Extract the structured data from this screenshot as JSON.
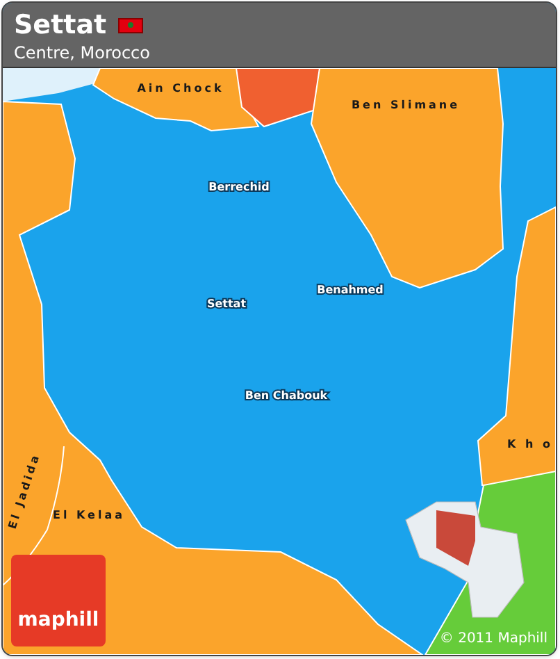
{
  "header": {
    "title": "Settat",
    "subtitle": "Centre, Morocco"
  },
  "map": {
    "places": [
      {
        "kind": "region",
        "label": "Ain Chock"
      },
      {
        "kind": "region",
        "label": "Ben Slimane"
      },
      {
        "kind": "town",
        "label": "Berrechid"
      },
      {
        "kind": "town",
        "label": "Settat"
      },
      {
        "kind": "town",
        "label": "Benahmed"
      },
      {
        "kind": "town",
        "label": "Ben Chabouk"
      },
      {
        "kind": "region",
        "label": "El Kelaa"
      },
      {
        "kind": "region",
        "label": "K h o"
      },
      {
        "kind": "region",
        "label": "El Jadida"
      }
    ],
    "copyright": "© 2011 Maphill",
    "logo": "maphill"
  }
}
